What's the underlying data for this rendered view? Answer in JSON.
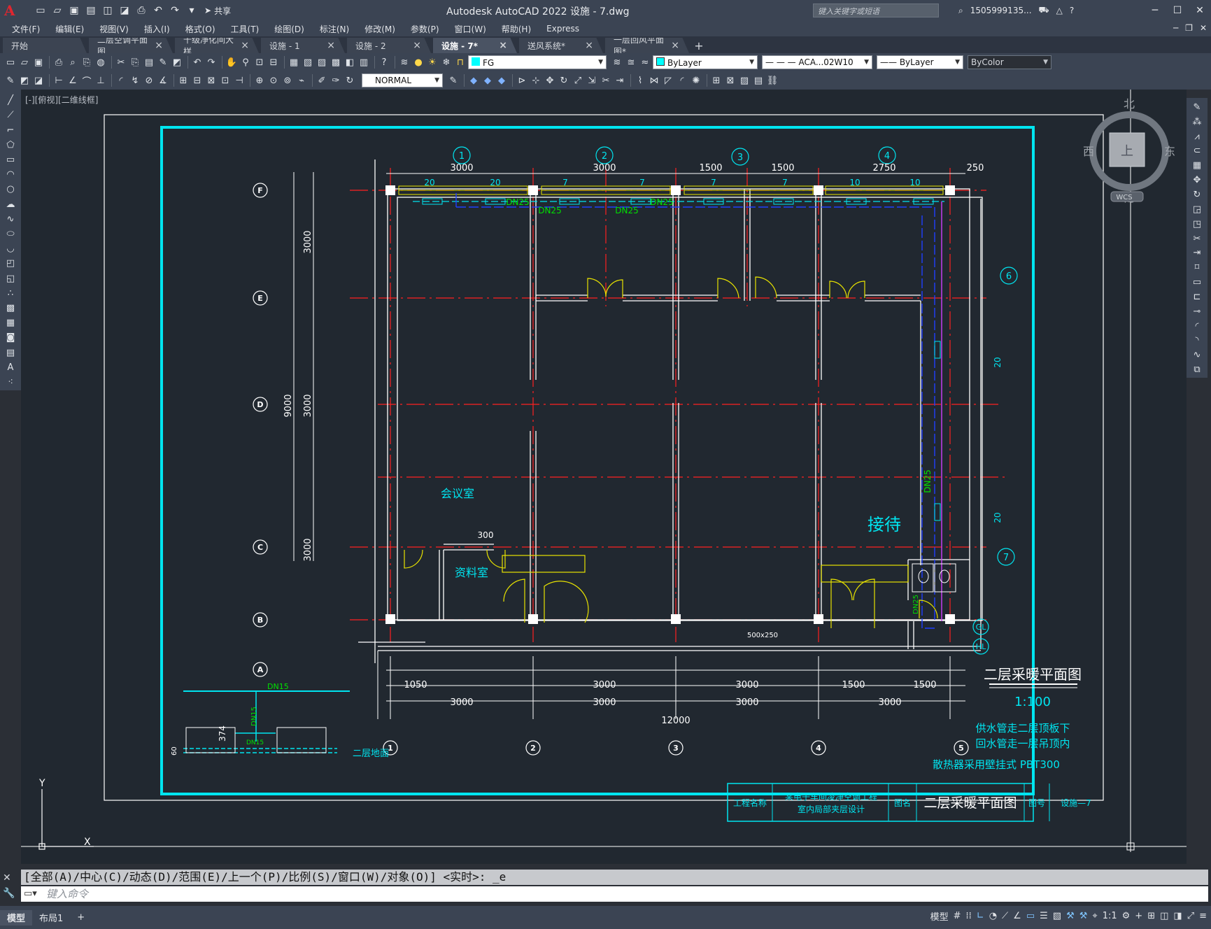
{
  "app": {
    "title": "Autodesk AutoCAD 2022    设施 - 7.dwg",
    "share_label": "共享",
    "search_placeholder": "键入关键字或短语",
    "user": "1505999135...",
    "logo_letter": "A"
  },
  "menu": [
    "文件(F)",
    "编辑(E)",
    "视图(V)",
    "插入(I)",
    "格式(O)",
    "工具(T)",
    "绘图(D)",
    "标注(N)",
    "修改(M)",
    "参数(P)",
    "窗口(W)",
    "帮助(H)",
    "Express"
  ],
  "tabs": [
    {
      "label": "开始",
      "closable": false,
      "active": false
    },
    {
      "label": "二层空调平面图",
      "closable": true,
      "active": false
    },
    {
      "label": "千级净化间大样",
      "closable": true,
      "active": false
    },
    {
      "label": "设施 - 1",
      "closable": true,
      "active": false
    },
    {
      "label": "设施 - 2",
      "closable": true,
      "active": false
    },
    {
      "label": "设施 - 7*",
      "closable": true,
      "active": true
    },
    {
      "label": "送风系统*",
      "closable": true,
      "active": false
    },
    {
      "label": "一层回风平面图*",
      "closable": true,
      "active": false
    }
  ],
  "toolbar": {
    "layer_name": "FG",
    "color_value": "ByLayer",
    "linetype_value": "ACA...02W10",
    "lineweight_value": "ByLayer",
    "plotstyle_value": "ByColor",
    "dimstyle_value": "NORMAL",
    "layer_swatch": "#00ffff"
  },
  "viewport": {
    "label": "[-][俯视][二维线框]",
    "viewcube": {
      "north": "北",
      "south": "南",
      "east": "东",
      "west": "西",
      "top": "上",
      "wcs": "WCS"
    },
    "ucs": {
      "x": "X",
      "y": "Y"
    }
  },
  "drawing": {
    "axes_top": [
      "1",
      "2",
      "3",
      "4"
    ],
    "axes_bottom": [
      "1",
      "2",
      "3",
      "4",
      "5"
    ],
    "axes_left": [
      "F",
      "E",
      "D",
      "C",
      "B",
      "A"
    ],
    "axes_right": [
      "6",
      "7"
    ],
    "dims_top": [
      "3000",
      "3000",
      "1500",
      "1500",
      "2750",
      "250"
    ],
    "dims_left": [
      "3000",
      "3000",
      "9000",
      "3000"
    ],
    "dims_bottom_row1": [
      "1050",
      "3000",
      "3000",
      "1500",
      "1500"
    ],
    "dims_bottom_row2": [
      "3000",
      "3000",
      "3000",
      "3000"
    ],
    "dims_total": "12000",
    "radiator_counts": [
      "20",
      "20",
      "7",
      "7",
      "7",
      "7",
      "10",
      "10"
    ],
    "pipe_labels": [
      "DN25",
      "DN25",
      "DN25",
      "DN25",
      "DN25",
      "DN25",
      "DN15",
      "DN15",
      "DN15"
    ],
    "rooms": {
      "meeting": "会议室",
      "archive": "资料室",
      "reception": "接待"
    },
    "misc_labels": {
      "dim300": "300",
      "duct": "500x250",
      "gl": "GL",
      "hl": "HL",
      "r20a": "20",
      "r20b": "20",
      "detail374": "374",
      "detail60": "60",
      "second_floor": "二层地面"
    },
    "plan_title": "二层采暖平面图",
    "scale": "1:100",
    "notes": [
      "供水管走二层顶板下",
      "回水管走一层吊顶内",
      "散热器采用壁挂式 PBT300"
    ],
    "titleblock": {
      "project_label": "工程名称",
      "project_name_1": "某电子车间凌净空调工程",
      "project_name_2": "室内局部夹层设计",
      "drawing_name_label": "图名",
      "drawing_name": "二层采暖平面图",
      "drawing_no_label": "图号",
      "drawing_no": "设施—7"
    }
  },
  "command": {
    "history": "[全部(A)/中心(C)/动态(D)/范围(E)/上一个(P)/比例(S)/窗口(W)/对象(O)] <实时>: _e",
    "placeholder": "键入命令"
  },
  "status": {
    "layouts": [
      "模型",
      "布局1"
    ],
    "model_label": "模型",
    "scale": "1:1"
  }
}
